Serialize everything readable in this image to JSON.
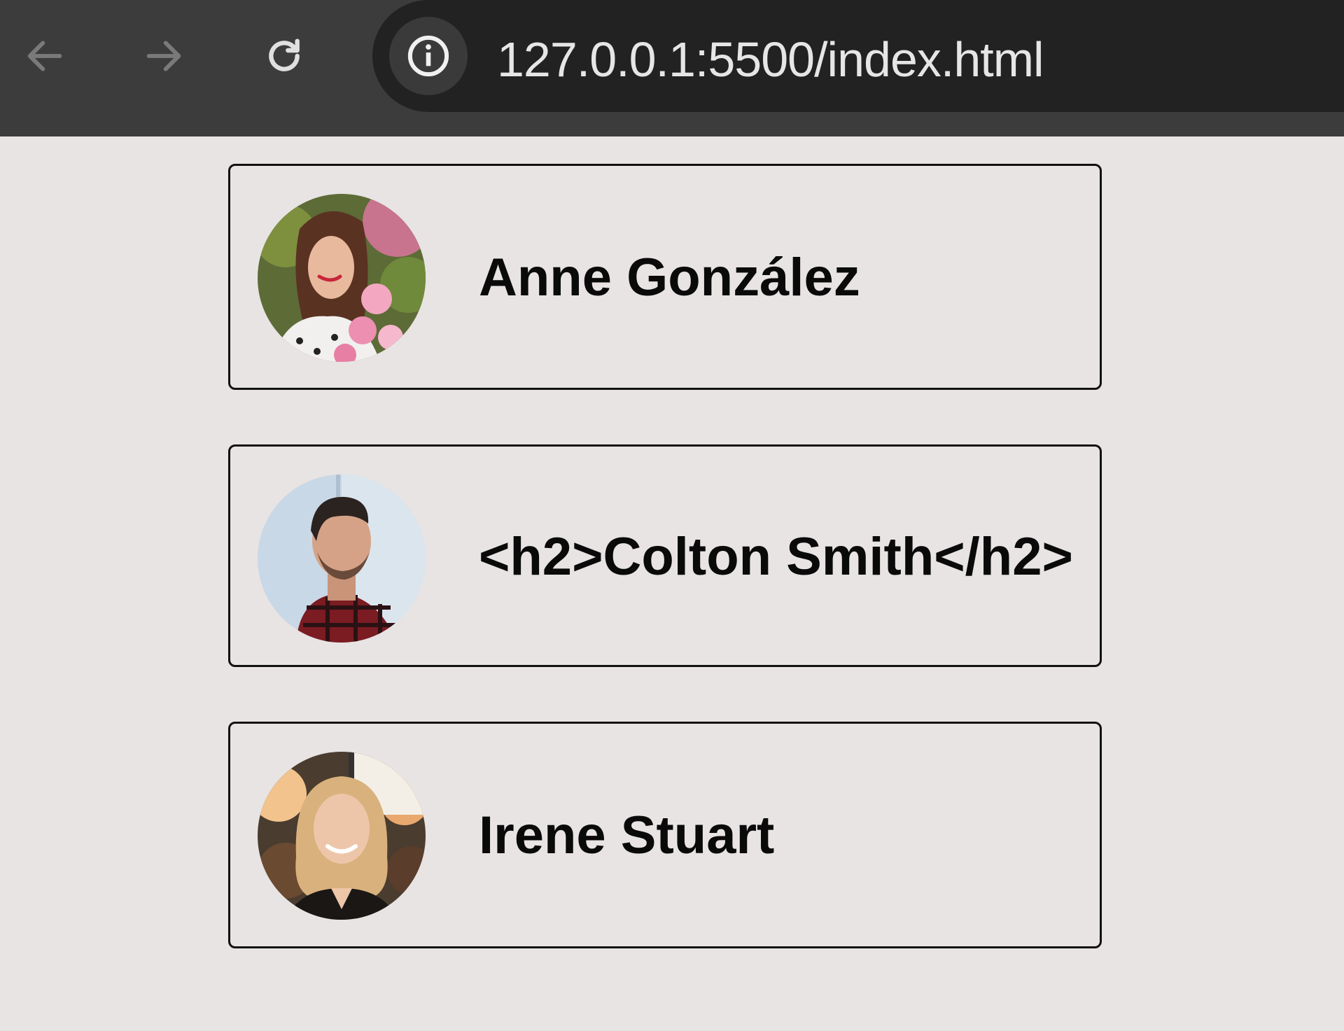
{
  "browser": {
    "back_icon": "arrow-left-icon",
    "forward_icon": "arrow-right-icon",
    "reload_icon": "reload-icon",
    "site_info_icon": "info-icon",
    "url": "127.0.0.1:5500/index.html"
  },
  "cards": [
    {
      "name": "Anne González",
      "avatar": "avatar-photo-woman-flowers"
    },
    {
      "name": "<h2>Colton Smith</h2>",
      "avatar": "avatar-photo-man-plaid-shirt"
    },
    {
      "name": "Irene Stuart",
      "avatar": "avatar-photo-woman-blonde"
    }
  ]
}
